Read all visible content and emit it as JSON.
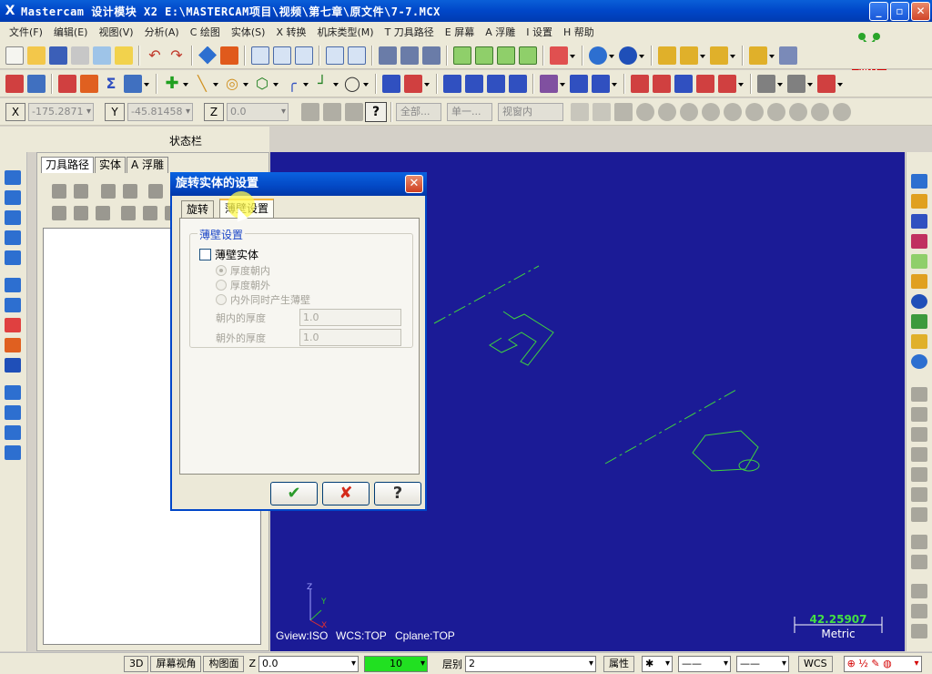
{
  "window": {
    "app_name": "Mastercam 设计模块",
    "title": "Mastercam 设计模块  X2  E:\\MASTERCAM项目\\视频\\第七章\\原文件\\7-7.MCX",
    "controls": [
      "minimize",
      "maximize",
      "close"
    ]
  },
  "menubar": {
    "items": [
      "文件(F)",
      "编辑(E)",
      "视图(V)",
      "分析(A)",
      "C 绘图",
      "实体(S)",
      "X 转换",
      "机床类型(M)",
      "T 刀具路径",
      "E 屏幕",
      "A 浮雕",
      "I 设置",
      "H 帮助"
    ]
  },
  "brand": {
    "text_top": "育碟",
    "text_bottom": "软件",
    "color": "#d40000"
  },
  "coordbar": {
    "x_label": "X",
    "x_value": "-175.2871",
    "y_label": "Y",
    "y_value": "-45.81458",
    "z_label": "Z",
    "z_value": "0.0",
    "help_label": "?",
    "select_all": "全部...",
    "select_single": "单一...",
    "view_mode": "视窗内"
  },
  "status_label": "状态栏",
  "ops_panel": {
    "tabs": [
      "刀具路径",
      "实体",
      "A 浮雕"
    ],
    "active_tab": 0
  },
  "viewport": {
    "background": "#1b1b96",
    "gview": "Gview:ISO",
    "wcs": "WCS:TOP",
    "cplane": "Cplane:TOP",
    "scale_value": "42.25907",
    "scale_unit": "Metric",
    "axis_labels": {
      "x": "X",
      "y": "Y",
      "z": "Z"
    }
  },
  "dialog": {
    "title": "旋转实体的设置",
    "tabs": [
      "旋转",
      "薄壁设置"
    ],
    "active_tab": 1,
    "group_title": "薄壁设置",
    "thin_wall_checkbox": "薄壁实体",
    "thin_wall_checked": false,
    "radio_options": [
      "厚度朝内",
      "厚度朝外",
      "内外同时产生薄壁"
    ],
    "radio_selected": 0,
    "inward_label": "朝内的厚度",
    "inward_value": "1.0",
    "outward_label": "朝外的厚度",
    "outward_value": "1.0",
    "ok_icon": "✔",
    "cancel_icon": "✘",
    "help_icon": "?"
  },
  "bottombar": {
    "btn_3d": "3D",
    "btn_screen_view": "屏幕视角",
    "btn_cplane": "构图面",
    "z_label": "Z",
    "z_value": "0.0",
    "color_value": "10",
    "level_label": "层别",
    "level_value": "2",
    "attr_label": "属性",
    "wcs_label": "WCS"
  },
  "colors": {
    "accent_blue": "#0046c8",
    "geometry_green": "#3fd23f",
    "color_swatch": "#21e021"
  }
}
